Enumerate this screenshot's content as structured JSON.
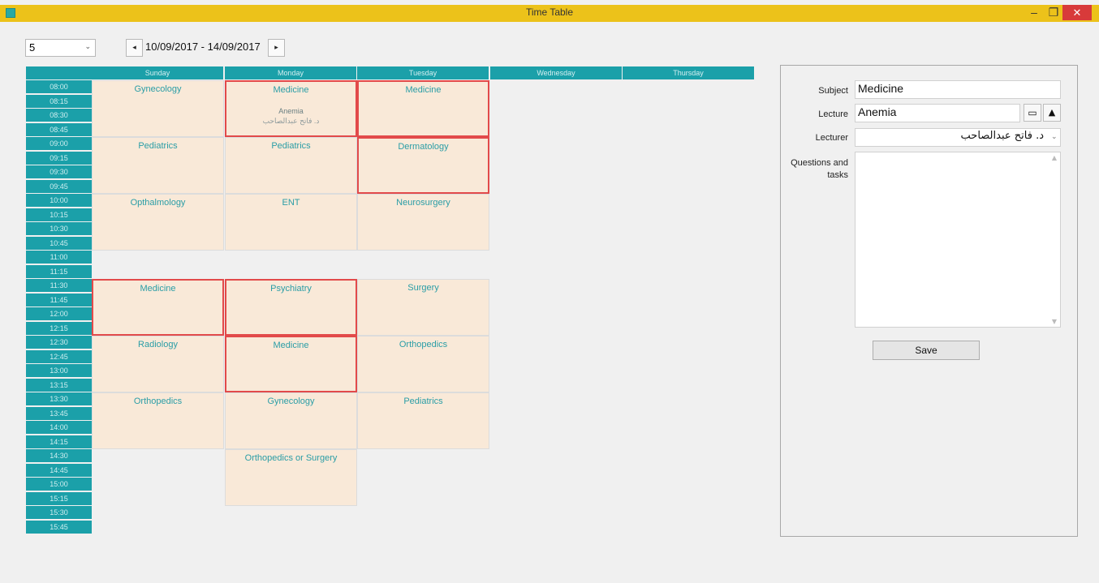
{
  "window": {
    "title": "Time Table",
    "minimize": "–",
    "maximize": "❐",
    "close": "✕"
  },
  "toolbar": {
    "week_value": "5",
    "date_range": "10/09/2017 - 14/09/2017",
    "prev_icon": "◂",
    "next_icon": "▸"
  },
  "days": [
    "Sunday",
    "Monday",
    "Tuesday",
    "Wednesday",
    "Thursday"
  ],
  "times": [
    "08:00",
    "08:15",
    "08:30",
    "08:45",
    "09:00",
    "09:15",
    "09:30",
    "09:45",
    "10:00",
    "10:15",
    "10:30",
    "10:45",
    "11:00",
    "11:15",
    "11:30",
    "11:45",
    "12:00",
    "12:15",
    "12:30",
    "12:45",
    "13:00",
    "13:15",
    "13:30",
    "13:45",
    "14:00",
    "14:15",
    "14:30",
    "14:45",
    "15:00",
    "15:15",
    "15:30",
    "15:45"
  ],
  "sessions": [
    {
      "day": 0,
      "start": "08:00",
      "subject": "Gynecology",
      "highlight": false
    },
    {
      "day": 1,
      "start": "08:00",
      "subject": "Medicine",
      "lecture": "Anemia",
      "lecturer": "د. فاتح عبدالصاحب",
      "highlight": true
    },
    {
      "day": 2,
      "start": "08:00",
      "subject": "Medicine",
      "highlight": true
    },
    {
      "day": 0,
      "start": "09:00",
      "subject": "Pediatrics",
      "highlight": false
    },
    {
      "day": 1,
      "start": "09:00",
      "subject": "Pediatrics",
      "highlight": false
    },
    {
      "day": 2,
      "start": "09:00",
      "subject": "Dermatology",
      "highlight": true
    },
    {
      "day": 0,
      "start": "10:00",
      "subject": "Opthalmology",
      "highlight": false
    },
    {
      "day": 1,
      "start": "10:00",
      "subject": "ENT",
      "highlight": false
    },
    {
      "day": 2,
      "start": "10:00",
      "subject": "Neurosurgery",
      "highlight": false
    },
    {
      "day": 0,
      "start": "11:30",
      "subject": "Medicine",
      "highlight": true
    },
    {
      "day": 1,
      "start": "11:30",
      "subject": "Psychiatry",
      "highlight": true
    },
    {
      "day": 2,
      "start": "11:30",
      "subject": "Surgery",
      "highlight": false
    },
    {
      "day": 0,
      "start": "12:30",
      "subject": "Radiology",
      "highlight": false
    },
    {
      "day": 1,
      "start": "12:30",
      "subject": "Medicine",
      "highlight": true
    },
    {
      "day": 2,
      "start": "12:30",
      "subject": "Orthopedics",
      "highlight": false
    },
    {
      "day": 0,
      "start": "13:30",
      "subject": "Orthopedics",
      "highlight": false
    },
    {
      "day": 1,
      "start": "13:30",
      "subject": "Gynecology",
      "highlight": false
    },
    {
      "day": 2,
      "start": "13:30",
      "subject": "Pediatrics",
      "highlight": false
    },
    {
      "day": 1,
      "start": "14:30",
      "subject": "Orthopedics or Surgery",
      "highlight": false
    }
  ],
  "details": {
    "subject_label": "Subject",
    "subject_value": "Medicine",
    "lecture_label": "Lecture",
    "lecture_value": "Anemia",
    "lecturer_label": "Lecturer",
    "lecturer_value": "د. فاتح عبدالصاحب",
    "questions_label": "Questions and tasks",
    "questions_value": "",
    "save_label": "Save",
    "book_icon": "📖",
    "up_icon": "▲"
  },
  "colors": {
    "header_teal": "#1ba0a9",
    "cell_bg": "#f9e9d8",
    "highlight_border": "#e24a4a",
    "title_bar": "#ecc21a"
  }
}
